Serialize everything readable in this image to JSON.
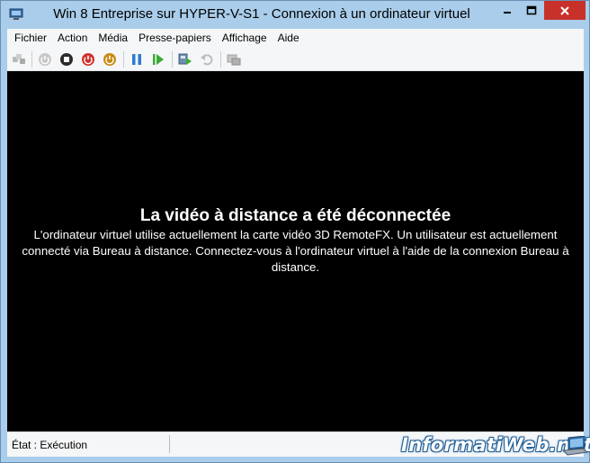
{
  "window": {
    "title": "Win 8 Entreprise sur HYPER-V-S1 - Connexion à un ordinateur virtuel"
  },
  "menu": {
    "items": [
      "Fichier",
      "Action",
      "Média",
      "Presse-papiers",
      "Affichage",
      "Aide"
    ]
  },
  "toolbar": {
    "buttons": [
      {
        "icon": "ctrl-alt-del-icon",
        "enabled": false
      },
      {
        "icon": "start-icon",
        "enabled": false
      },
      {
        "icon": "turn-off-icon",
        "enabled": true
      },
      {
        "icon": "shut-down-icon",
        "enabled": true
      },
      {
        "icon": "save-icon",
        "enabled": true
      },
      {
        "icon": "pause-icon",
        "enabled": true
      },
      {
        "icon": "reset-icon",
        "enabled": true
      },
      {
        "icon": "snapshot-icon",
        "enabled": true
      },
      {
        "icon": "revert-icon",
        "enabled": false
      },
      {
        "icon": "enhanced-session-icon",
        "enabled": false
      }
    ]
  },
  "screen": {
    "title": "La vidéo à distance a été déconnectée",
    "message": "L'ordinateur virtuel utilise actuellement la carte vidéo 3D RemoteFX. Un utilisateur est actuellement connecté via Bureau à distance. Connectez-vous à l'ordinateur virtuel à l'aide de la connexion Bureau à distance."
  },
  "status": {
    "state": "État : Exécution"
  },
  "watermark": {
    "text": "InformatiWeb.net"
  },
  "colors": {
    "titlebar": "#a9cdea",
    "close_button": "#c7312a",
    "screen_background": "#000000",
    "accent_green": "#3aaa35",
    "accent_blue": "#2b7cd3",
    "accent_red": "#d0312d",
    "accent_orange": "#c98a13"
  }
}
